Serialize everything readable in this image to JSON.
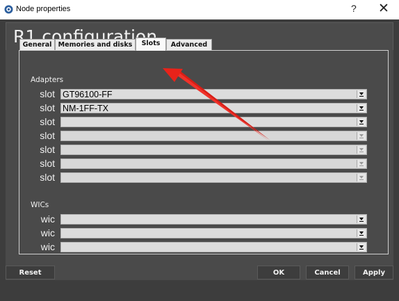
{
  "window": {
    "title": "Node properties",
    "help_label": "?",
    "close_label": "✕"
  },
  "dialog": {
    "title": "R1 configuration"
  },
  "tabs": [
    {
      "label": "General"
    },
    {
      "label": "Memories and disks"
    },
    {
      "label": "Slots",
      "active": true
    },
    {
      "label": "Advanced"
    }
  ],
  "adapters": {
    "group_label": "Adapters",
    "rows": [
      {
        "label": "slot",
        "value": "GT96100-FF"
      },
      {
        "label": "slot",
        "value": "NM-1FF-TX"
      },
      {
        "label": "slot",
        "value": ""
      },
      {
        "label": "slot",
        "value": ""
      },
      {
        "label": "slot",
        "value": ""
      },
      {
        "label": "slot",
        "value": ""
      },
      {
        "label": "slot",
        "value": ""
      }
    ]
  },
  "wics": {
    "group_label": "WICs",
    "rows": [
      {
        "label": "wic",
        "value": ""
      },
      {
        "label": "wic",
        "value": ""
      },
      {
        "label": "wic",
        "value": ""
      }
    ]
  },
  "footer": {
    "reset_label": "Reset",
    "ok_label": "OK",
    "cancel_label": "Cancel",
    "apply_label": "Apply"
  },
  "colors": {
    "background": "#3d3d3d",
    "panel": "#4a4a4a",
    "annotation_arrow": "#e8231a"
  }
}
